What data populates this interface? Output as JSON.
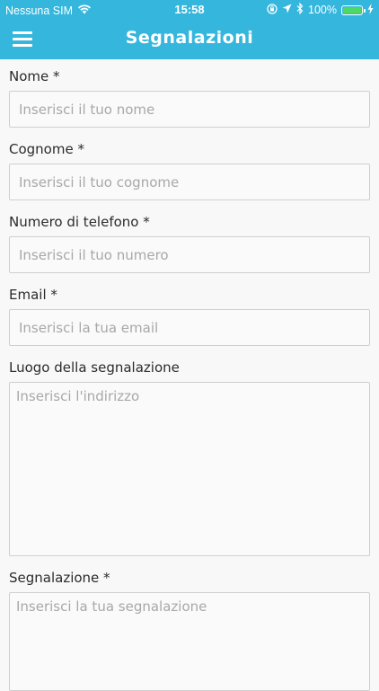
{
  "status_bar": {
    "carrier": "Nessuna SIM",
    "time": "15:58",
    "battery_percent": "100%",
    "battery_level": 1.0,
    "battery_color": "#4cd964",
    "icons": [
      "wifi-icon",
      "orientation-lock-icon",
      "location-arrow-icon",
      "bluetooth-icon",
      "battery-icon",
      "charging-bolt-icon"
    ]
  },
  "header": {
    "title": "Segnalazioni",
    "menu_icon": "hamburger-menu-icon",
    "background_color": "#35b6dc"
  },
  "form": {
    "nome": {
      "label": "Nome *",
      "placeholder": "Inserisci il tuo nome",
      "value": ""
    },
    "cognome": {
      "label": "Cognome *",
      "placeholder": "Inserisci il tuo cognome",
      "value": ""
    },
    "telefono": {
      "label": "Numero di telefono *",
      "placeholder": "Inserisci il tuo numero",
      "value": ""
    },
    "email": {
      "label": "Email *",
      "placeholder": "Inserisci la tua email",
      "value": ""
    },
    "luogo": {
      "label": "Luogo della segnalazione",
      "placeholder": "Inserisci l'indirizzo",
      "value": ""
    },
    "segnalazione": {
      "label": "Segnalazione *",
      "placeholder": "Inserisci la tua segnalazione",
      "value": ""
    }
  }
}
